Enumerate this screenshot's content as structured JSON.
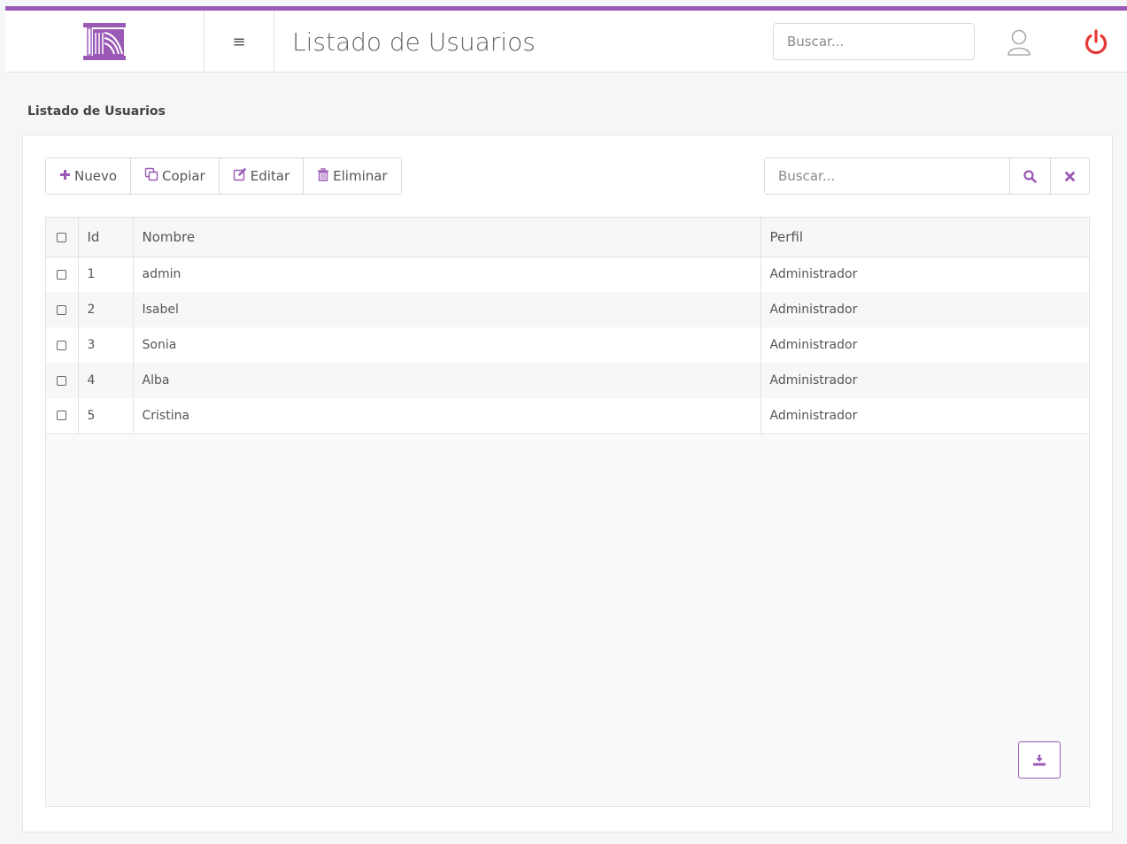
{
  "header": {
    "title": "Listado de Usuarios",
    "search_placeholder": "Buscar...",
    "menu_glyph": "≡"
  },
  "breadcrumb": "Listado de Usuarios",
  "toolbar": {
    "buttons": [
      {
        "label": "Nuevo",
        "icon": "plus-icon"
      },
      {
        "label": "Copiar",
        "icon": "copy-icon"
      },
      {
        "label": "Editar",
        "icon": "edit-icon"
      },
      {
        "label": "Eliminar",
        "icon": "trash-icon"
      }
    ],
    "search_placeholder": "Buscar..."
  },
  "table": {
    "columns": [
      "Id",
      "Nombre",
      "Perfil"
    ],
    "rows": [
      {
        "id": "1",
        "nombre": "admin",
        "perfil": "Administrador"
      },
      {
        "id": "2",
        "nombre": "Isabel",
        "perfil": "Administrador"
      },
      {
        "id": "3",
        "nombre": "Sonia",
        "perfil": "Administrador"
      },
      {
        "id": "4",
        "nombre": "Alba",
        "perfil": "Administrador"
      },
      {
        "id": "5",
        "nombre": "Cristina",
        "perfil": "Administrador"
      }
    ]
  },
  "colors": {
    "accent": "#9b59b6",
    "power": "#e53935"
  }
}
